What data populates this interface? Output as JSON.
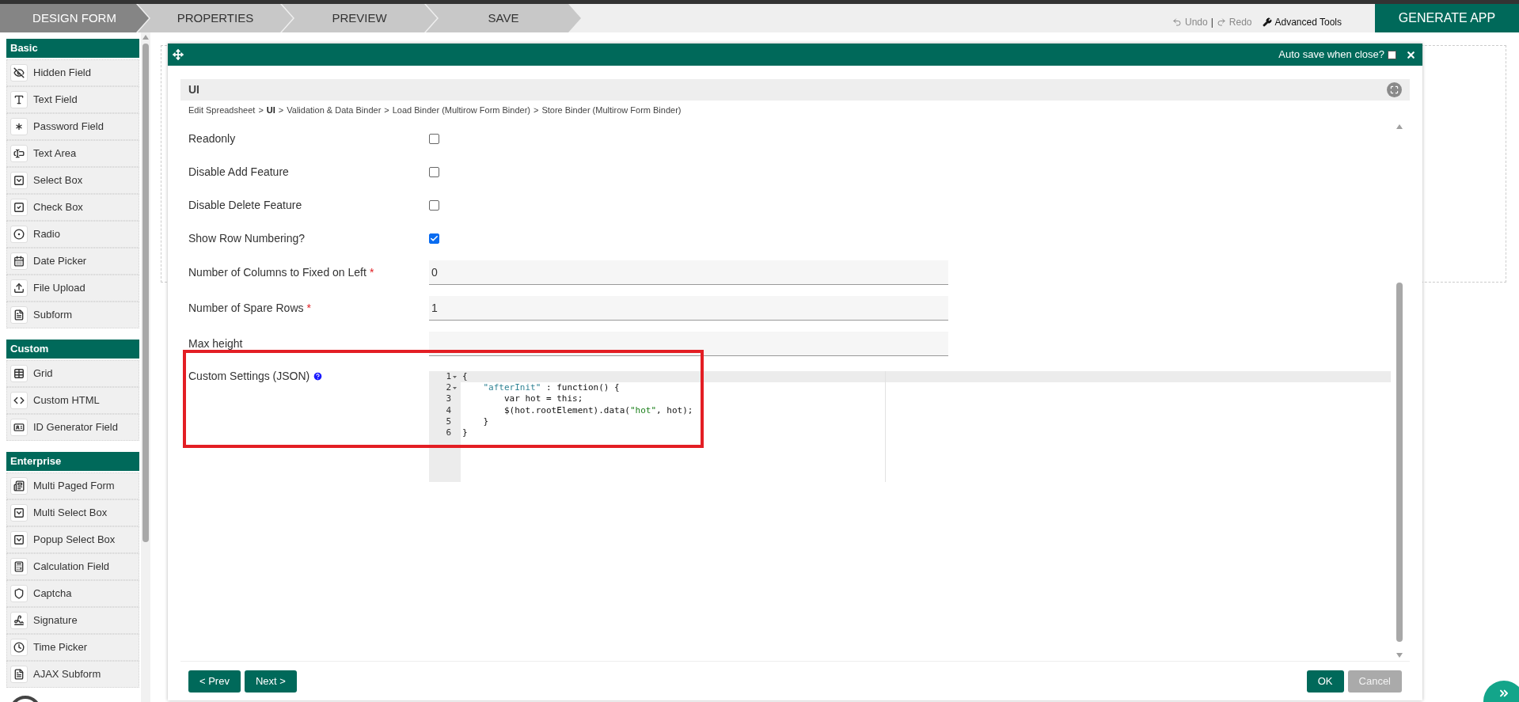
{
  "top_tabs": [
    {
      "label": "DESIGN FORM",
      "selected": true
    },
    {
      "label": "PROPERTIES",
      "selected": false
    },
    {
      "label": "PREVIEW",
      "selected": false
    },
    {
      "label": "SAVE",
      "selected": false
    }
  ],
  "toolbar": {
    "undo": "Undo",
    "separator": "|",
    "redo": "Redo",
    "advanced_tools": "Advanced Tools",
    "generate": "GENERATE APP"
  },
  "sidebar": [
    {
      "title": "Basic",
      "items": [
        {
          "label": "Hidden Field"
        },
        {
          "label": "Text Field"
        },
        {
          "label": "Password Field"
        },
        {
          "label": "Text Area"
        },
        {
          "label": "Select Box"
        },
        {
          "label": "Check Box"
        },
        {
          "label": "Radio"
        },
        {
          "label": "Date Picker"
        },
        {
          "label": "File Upload"
        },
        {
          "label": "Subform"
        }
      ]
    },
    {
      "title": "Custom",
      "items": [
        {
          "label": "Grid"
        },
        {
          "label": "Custom HTML"
        },
        {
          "label": "ID Generator Field"
        }
      ]
    },
    {
      "title": "Enterprise",
      "items": [
        {
          "label": "Multi Paged Form"
        },
        {
          "label": "Multi Select Box"
        },
        {
          "label": "Popup Select Box"
        },
        {
          "label": "Calculation Field"
        },
        {
          "label": "Captcha"
        },
        {
          "label": "Signature"
        },
        {
          "label": "Time Picker"
        },
        {
          "label": "AJAX Subform"
        }
      ]
    }
  ],
  "dialog": {
    "auto_save": {
      "label": "Auto save when close?",
      "checked": false
    },
    "section_title": "UI",
    "breadcrumb": [
      {
        "label": "Edit Spreadsheet",
        "selected": false
      },
      {
        "label": "UI",
        "selected": true
      },
      {
        "label": "Validation & Data Binder",
        "selected": false
      },
      {
        "label": "Load Binder (Multirow Form Binder)",
        "selected": false
      },
      {
        "label": "Store Binder (Multirow Form Binder)",
        "selected": false
      }
    ],
    "breadcrumb_separator": ">",
    "fields": [
      {
        "kind": "checkbox",
        "label": "Readonly",
        "checked": false
      },
      {
        "kind": "checkbox",
        "label": "Disable Add Feature",
        "checked": false
      },
      {
        "kind": "checkbox",
        "label": "Disable Delete Feature",
        "checked": false
      },
      {
        "kind": "checkbox",
        "label": "Show Row Numbering?",
        "checked": true
      },
      {
        "kind": "text",
        "label": "Number of Columns to Fixed on Left",
        "required_mark": "*",
        "value": "0"
      },
      {
        "kind": "text",
        "label": "Number of Spare Rows",
        "required_mark": "*",
        "value": "1"
      },
      {
        "kind": "text",
        "label": "Max height"
      },
      {
        "kind": "code",
        "label": "Custom Settings (JSON)",
        "help": true,
        "lines": [
          {
            "number": "1",
            "foldable": true,
            "segments": [
              {
                "kind": "plain",
                "text": "{"
              }
            ]
          },
          {
            "number": "2",
            "foldable": true,
            "segments": [
              {
                "kind": "key",
                "text": "    \"afterInit\""
              },
              {
                "kind": "plain",
                "text": " : function() {"
              }
            ]
          },
          {
            "number": "3",
            "foldable": false,
            "segments": [
              {
                "kind": "plain",
                "text": "        var hot = this;"
              }
            ]
          },
          {
            "number": "4",
            "foldable": false,
            "segments": [
              {
                "kind": "plain",
                "text": "        $(hot.rootElement).data("
              },
              {
                "kind": "string",
                "text": "\"hot\""
              },
              {
                "kind": "plain",
                "text": ", hot);"
              }
            ]
          },
          {
            "number": "5",
            "foldable": false,
            "segments": [
              {
                "kind": "plain",
                "text": "    }"
              }
            ]
          },
          {
            "number": "6",
            "foldable": false,
            "segments": [
              {
                "kind": "plain",
                "text": "}"
              }
            ]
          }
        ]
      }
    ],
    "buttons": [
      {
        "kind": "nav",
        "label": "< Prev",
        "disabled": false
      },
      {
        "kind": "nav",
        "label": "Next >",
        "disabled": false
      },
      {
        "kind": "action",
        "label": "OK",
        "disabled": false
      },
      {
        "kind": "action",
        "label": "Cancel",
        "disabled": true
      }
    ]
  }
}
